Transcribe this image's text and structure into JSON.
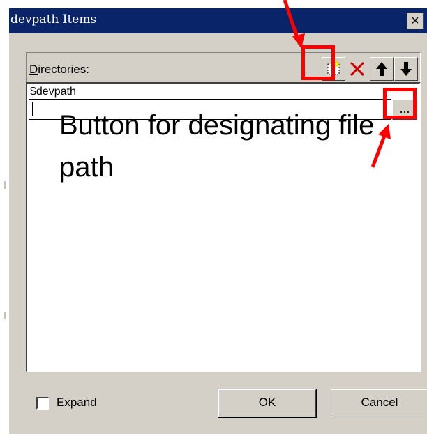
{
  "window": {
    "title": "devpath Items",
    "close_glyph": "×"
  },
  "directories": {
    "label_prefix": "",
    "label_access_key": "D",
    "label_rest": "irectories:",
    "toolbar": [
      {
        "name": "new-item-button",
        "icon": "new-folder-icon"
      },
      {
        "name": "delete-item-button",
        "icon": "delete-x-icon"
      },
      {
        "name": "move-up-button",
        "icon": "arrow-up-icon"
      },
      {
        "name": "move-down-button",
        "icon": "arrow-down-icon"
      }
    ],
    "items": [
      {
        "label": "$devpath"
      }
    ],
    "edit_value": "",
    "browse_label": "..."
  },
  "annotation": {
    "text": "Button for designating file path"
  },
  "footer": {
    "expand_label": "Expand",
    "ok_label": "OK",
    "cancel_label": "Cancel"
  },
  "colors": {
    "titlebar": "#0a246a",
    "dialog_bg": "#d4d0c8",
    "highlight": "#ff0000"
  }
}
